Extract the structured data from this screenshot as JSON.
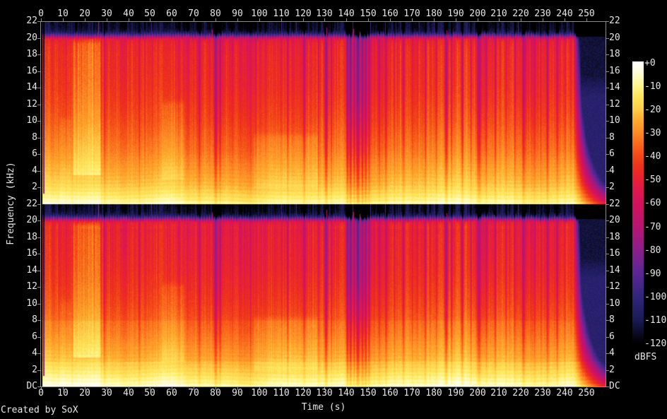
{
  "credit": "Created by SoX",
  "colors": {
    "background": "#000000",
    "axis": "#8c8c8c",
    "text": "#e6e6e6"
  },
  "chart_data": {
    "type": "heatmap",
    "subtype": "audio-spectrogram-stereo",
    "title": "",
    "xlabel": "Time (s)",
    "ylabel": "Frequency (kHz)",
    "channels": 2,
    "x_ticks": [
      0,
      10,
      20,
      30,
      40,
      50,
      60,
      70,
      80,
      90,
      100,
      110,
      120,
      130,
      140,
      150,
      160,
      170,
      180,
      190,
      200,
      210,
      220,
      230,
      240,
      250
    ],
    "x_range_s": [
      0,
      258.5
    ],
    "y_range_khz": [
      0,
      22
    ],
    "freq_tick_step_khz": 2,
    "dc_label": "DC",
    "colorbar": {
      "label": "dBFS",
      "ticks": [
        "+0",
        "-10",
        "-20",
        "-30",
        "-40",
        "-50",
        "-60",
        "-70",
        "-80",
        "-90",
        "-100",
        "-110",
        "-120"
      ],
      "range_db": [
        0,
        -120
      ]
    },
    "colormap_stops": [
      [
        0,
        255,
        255,
        255
      ],
      [
        -5,
        255,
        252,
        210
      ],
      [
        -10,
        255,
        246,
        143
      ],
      [
        -15,
        255,
        228,
        90
      ],
      [
        -20,
        255,
        205,
        74
      ],
      [
        -25,
        255,
        170,
        45
      ],
      [
        -30,
        254,
        140,
        39
      ],
      [
        -35,
        250,
        105,
        28
      ],
      [
        -40,
        244,
        73,
        25
      ],
      [
        -45,
        238,
        48,
        30
      ],
      [
        -50,
        232,
        33,
        51
      ],
      [
        -55,
        222,
        24,
        80
      ],
      [
        -60,
        211,
        18,
        92
      ],
      [
        -70,
        184,
        21,
        114
      ],
      [
        -80,
        140,
        31,
        139
      ],
      [
        -90,
        91,
        39,
        148
      ],
      [
        -100,
        51,
        37,
        124
      ],
      [
        -110,
        26,
        26,
        85
      ],
      [
        -115,
        13,
        13,
        40
      ],
      [
        -120,
        0,
        0,
        0
      ]
    ],
    "envelope_db_by_khz": [
      [
        0,
        -4
      ],
      [
        0.12,
        -8
      ],
      [
        0.4,
        -11
      ],
      [
        0.9,
        -14
      ],
      [
        1.6,
        -18
      ],
      [
        2.5,
        -22
      ],
      [
        3.5,
        -25
      ],
      [
        5,
        -29
      ],
      [
        6.5,
        -33
      ],
      [
        8,
        -36
      ],
      [
        10,
        -40
      ],
      [
        12,
        -43
      ],
      [
        14,
        -45.5
      ],
      [
        16,
        -47
      ],
      [
        18,
        -48
      ],
      [
        19.3,
        -50
      ],
      [
        19.9,
        -53
      ],
      [
        20.15,
        -70
      ],
      [
        20.4,
        -95
      ],
      [
        20.7,
        -110
      ],
      [
        21.1,
        -115
      ],
      [
        22,
        -117
      ]
    ],
    "channel2_adjust": {
      "low_f": 3,
      "low_db": 2.5,
      "mid_f0": 8,
      "mid_f1": 19,
      "mid_db": -2
    },
    "boosts": [
      {
        "t0": 14.2,
        "t1": 27.6,
        "f0": 3.5,
        "f1": 19.3,
        "ft": 1.2,
        "db": 13
      },
      {
        "t0": 55,
        "t1": 66,
        "f0": 3,
        "f1": 12,
        "ft": 0.7,
        "db": 5
      },
      {
        "t0": 97,
        "t1": 127,
        "f0": 2,
        "f1": 8,
        "ft": 0.7,
        "db": 4
      },
      {
        "t0": 8,
        "t1": 14.2,
        "f0": 0,
        "f1": 10,
        "ft": 0.7,
        "db": 3
      }
    ],
    "dips": [
      [
        29,
        0.7,
        -14
      ],
      [
        45,
        0.6,
        -12
      ],
      [
        72.5,
        0.7,
        -15
      ],
      [
        80,
        1.6,
        -26
      ],
      [
        82,
        0.8,
        -18
      ],
      [
        96,
        0.5,
        -12
      ],
      [
        113,
        0.6,
        -13
      ],
      [
        120.5,
        0.7,
        -15
      ],
      [
        127,
        0.5,
        -12
      ],
      [
        130.6,
        1.3,
        -28
      ],
      [
        133,
        0.6,
        -14
      ],
      [
        140.3,
        1.0,
        -32
      ],
      [
        141.8,
        1.1,
        -38
      ],
      [
        143.4,
        0.9,
        -30
      ],
      [
        145.1,
        1.5,
        -42
      ],
      [
        147.2,
        1.0,
        -38
      ],
      [
        148.7,
        1.1,
        -32
      ],
      [
        150.2,
        0.8,
        -22
      ],
      [
        155,
        0.5,
        -12
      ],
      [
        158,
        0.9,
        -18
      ],
      [
        162,
        0.5,
        -10
      ],
      [
        166,
        0.8,
        -14
      ],
      [
        170,
        0.5,
        -10
      ],
      [
        176,
        0.6,
        -12
      ],
      [
        181,
        0.5,
        -11
      ],
      [
        185.6,
        1.4,
        -26
      ],
      [
        188,
        0.8,
        -18
      ],
      [
        193,
        1.0,
        -20
      ],
      [
        197,
        0.5,
        -12
      ],
      [
        200.6,
        1.6,
        -26
      ],
      [
        204,
        0.6,
        -12
      ],
      [
        208,
        0.8,
        -16
      ],
      [
        213,
        0.5,
        -11
      ],
      [
        217,
        0.6,
        -12
      ],
      [
        221,
        1.2,
        -22
      ],
      [
        226,
        0.5,
        -11
      ],
      [
        229,
        0.6,
        -12
      ],
      [
        232,
        1.0,
        -18
      ],
      [
        236.5,
        0.8,
        -14
      ],
      [
        240,
        0.6,
        -12
      ]
    ],
    "spikes": [
      [
        26.2,
        22
      ],
      [
        78.3,
        21
      ],
      [
        130.9,
        21.3
      ],
      [
        143.2,
        21.1
      ],
      [
        146.2,
        20.8
      ],
      [
        186,
        20.9
      ],
      [
        207.5,
        20.7
      ]
    ],
    "intro": {
      "silence_until": 0.55,
      "bursts": [
        [
          0.55,
          0.95
        ],
        [
          1.5,
          2.0
        ]
      ],
      "end": 2.2
    },
    "outro": {
      "start": 244,
      "k0": 3,
      "k1": 1.05
    },
    "seeds": [
      11,
      23,
      37,
      51,
      67,
      83,
      97
    ]
  }
}
